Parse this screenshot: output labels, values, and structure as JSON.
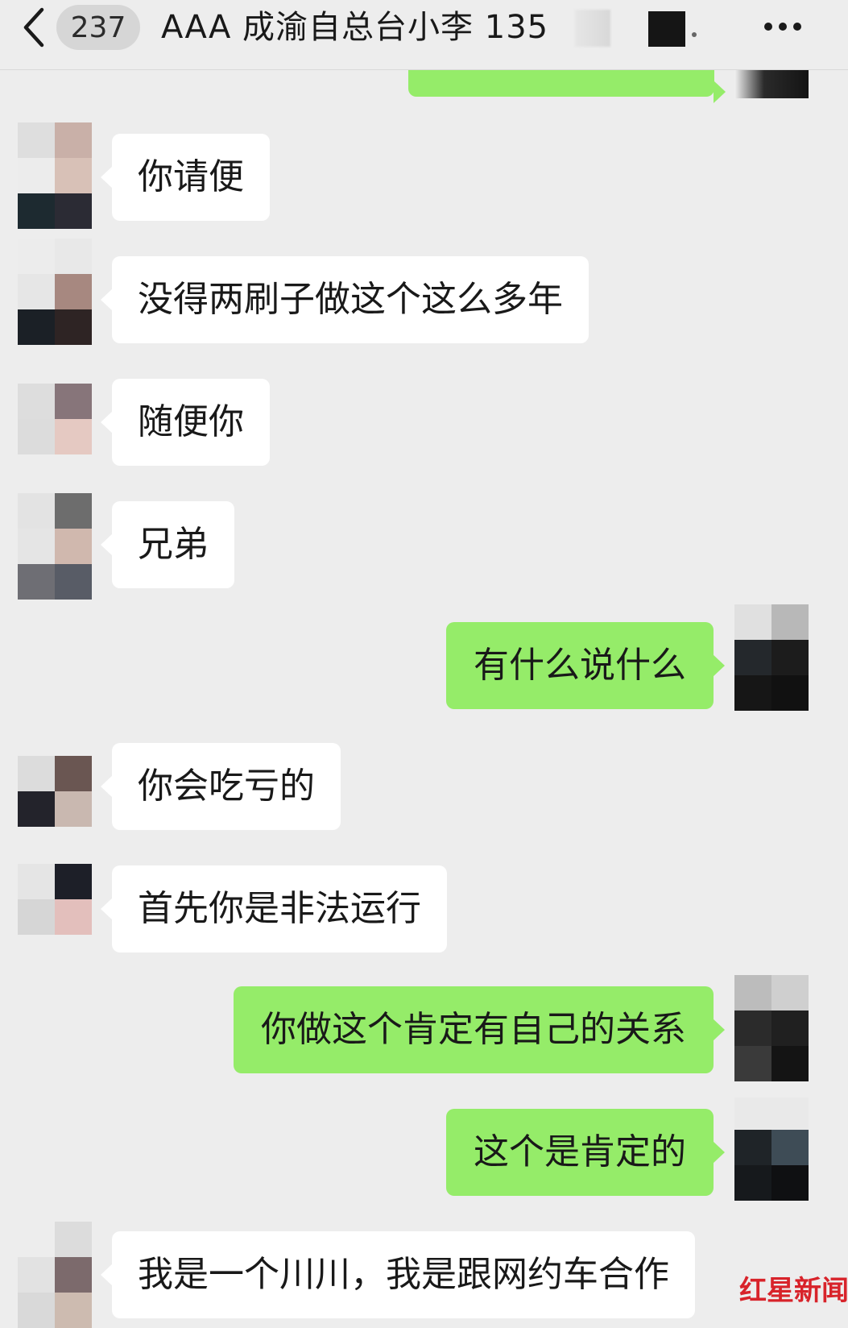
{
  "header": {
    "unread_count": "237",
    "title": "AAA 成渝自总台小李 135"
  },
  "icons": {
    "back": "chevron-left-icon",
    "more": "more-dots-icon"
  },
  "colors": {
    "background": "#ededed",
    "incoming_bubble": "#ffffff",
    "outgoing_bubble": "#95ec69",
    "watermark": "#d8232a"
  },
  "messages": [
    {
      "side": "in",
      "text": "你请便"
    },
    {
      "side": "in",
      "text": "没得两刷子做这个这么多年"
    },
    {
      "side": "in",
      "text": "随便你"
    },
    {
      "side": "in",
      "text": "兄弟"
    },
    {
      "side": "out",
      "text": "有什么说什么"
    },
    {
      "side": "in",
      "text": "你会吃亏的"
    },
    {
      "side": "in",
      "text": "首先你是非法运行"
    },
    {
      "side": "out",
      "text": "你做这个肯定有自己的关系"
    },
    {
      "side": "out",
      "text": "这个是肯定的"
    },
    {
      "side": "in",
      "text": "我是一个川川，我是跟网约车合作"
    }
  ],
  "watermark": "红星新闻"
}
